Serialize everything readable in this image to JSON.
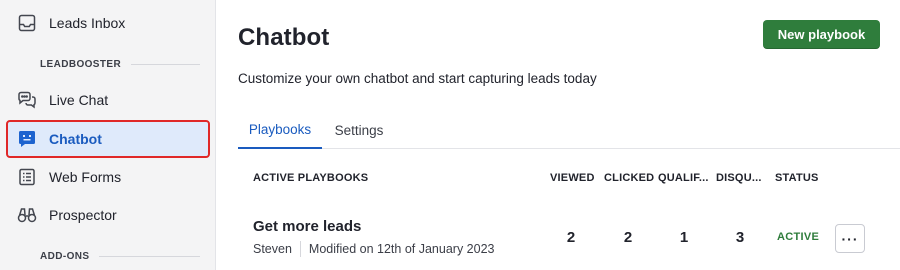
{
  "sidebar": {
    "top_item": {
      "label": "Leads Inbox",
      "icon": "inbox-icon"
    },
    "sections": [
      {
        "header": "LEADBOOSTER"
      },
      {
        "header": "ADD-ONS"
      }
    ],
    "items": [
      {
        "label": "Live Chat",
        "icon": "chat-bubbles-icon"
      },
      {
        "label": "Chatbot",
        "icon": "chatbot-icon",
        "active": true
      },
      {
        "label": "Web Forms",
        "icon": "form-list-icon"
      },
      {
        "label": "Prospector",
        "icon": "binoculars-icon"
      }
    ]
  },
  "header": {
    "title": "Chatbot",
    "new_playbook_label": "New playbook",
    "subtitle": "Customize your own chatbot and start capturing leads today"
  },
  "tabs": [
    {
      "label": "Playbooks",
      "active": true
    },
    {
      "label": "Settings",
      "active": false
    }
  ],
  "table": {
    "columns": [
      "ACTIVE PLAYBOOKS",
      "VIEWED",
      "CLICKED",
      "QUALIF...",
      "DISQU...",
      "STATUS"
    ],
    "rows": [
      {
        "name": "Get more leads",
        "owner": "Steven",
        "modified": "Modified on 12th of January 2023",
        "viewed": "2",
        "clicked": "2",
        "qualified": "1",
        "disqualified": "3",
        "status": "ACTIVE",
        "more_label": "···"
      }
    ]
  },
  "colors": {
    "accent_blue": "#1a5bbf",
    "primary_green": "#2f7d3c",
    "highlight_red": "#e02828",
    "sidebar_bg": "#f4f4f5"
  }
}
